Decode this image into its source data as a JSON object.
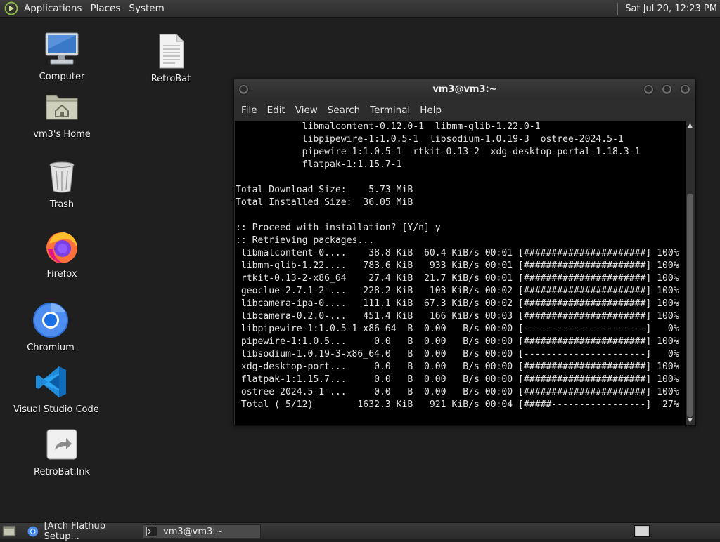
{
  "top_panel": {
    "menus": [
      "Applications",
      "Places",
      "System"
    ],
    "clock": "Sat Jul 20, 12:23 PM"
  },
  "desktop": {
    "icons": [
      {
        "label": "Computer",
        "icon": "computer-icon"
      },
      {
        "label": "RetroBat",
        "icon": "document-icon"
      },
      {
        "label": "vm3's Home",
        "icon": "home-folder-icon"
      },
      {
        "label": "Trash",
        "icon": "trash-icon"
      },
      {
        "label": "Firefox",
        "icon": "firefox-icon"
      },
      {
        "label": "Chromium",
        "icon": "chromium-icon"
      },
      {
        "label": "Visual Studio Code",
        "icon": "vscode-icon"
      },
      {
        "label": "RetroBat.lnk",
        "icon": "shortcut-icon"
      }
    ]
  },
  "terminal": {
    "title": "vm3@vm3:~",
    "menu": [
      "File",
      "Edit",
      "View",
      "Search",
      "Terminal",
      "Help"
    ],
    "lines": [
      "            libmalcontent-0.12.0-1  libmm-glib-1.22.0-1",
      "            libpipewire-1:1.0.5-1  libsodium-1.0.19-3  ostree-2024.5-1",
      "            pipewire-1:1.0.5-1  rtkit-0.13-2  xdg-desktop-portal-1.18.3-1",
      "            flatpak-1:1.15.7-1",
      "",
      "Total Download Size:    5.73 MiB",
      "Total Installed Size:  36.05 MiB",
      "",
      ":: Proceed with installation? [Y/n] y",
      ":: Retrieving packages...",
      " libmalcontent-0....    38.8 KiB  60.4 KiB/s 00:01 [######################] 100%",
      " libmm-glib-1.22....   783.6 KiB   933 KiB/s 00:01 [######################] 100%",
      " rtkit-0.13-2-x86_64    27.4 KiB  21.7 KiB/s 00:01 [######################] 100%",
      " geoclue-2.7.1-2-...   228.2 KiB   103 KiB/s 00:02 [######################] 100%",
      " libcamera-ipa-0....   111.1 KiB  67.3 KiB/s 00:02 [######################] 100%",
      " libcamera-0.2.0-...   451.4 KiB   166 KiB/s 00:03 [######################] 100%",
      " libpipewire-1:1.0.5-1-x86_64  B  0.00   B/s 00:00 [----------------------]   0%",
      " pipewire-1:1.0.5...     0.0   B  0.00   B/s 00:00 [######################] 100%",
      " libsodium-1.0.19-3-x86_64.0   B  0.00   B/s 00:00 [----------------------]   0%",
      " xdg-desktop-port...     0.0   B  0.00   B/s 00:00 [######################] 100%",
      " flatpak-1:1.15.7...     0.0   B  0.00   B/s 00:00 [######################] 100%",
      " ostree-2024.5-1-...     0.0   B  0.00   B/s 00:00 [######################] 100%",
      " Total ( 5/12)        1632.3 KiB   921 KiB/s 00:04 [#####-----------------]  27%"
    ]
  },
  "taskbar": {
    "tasks": [
      "[Arch Flathub Setup...",
      "vm3@vm3:~"
    ]
  }
}
